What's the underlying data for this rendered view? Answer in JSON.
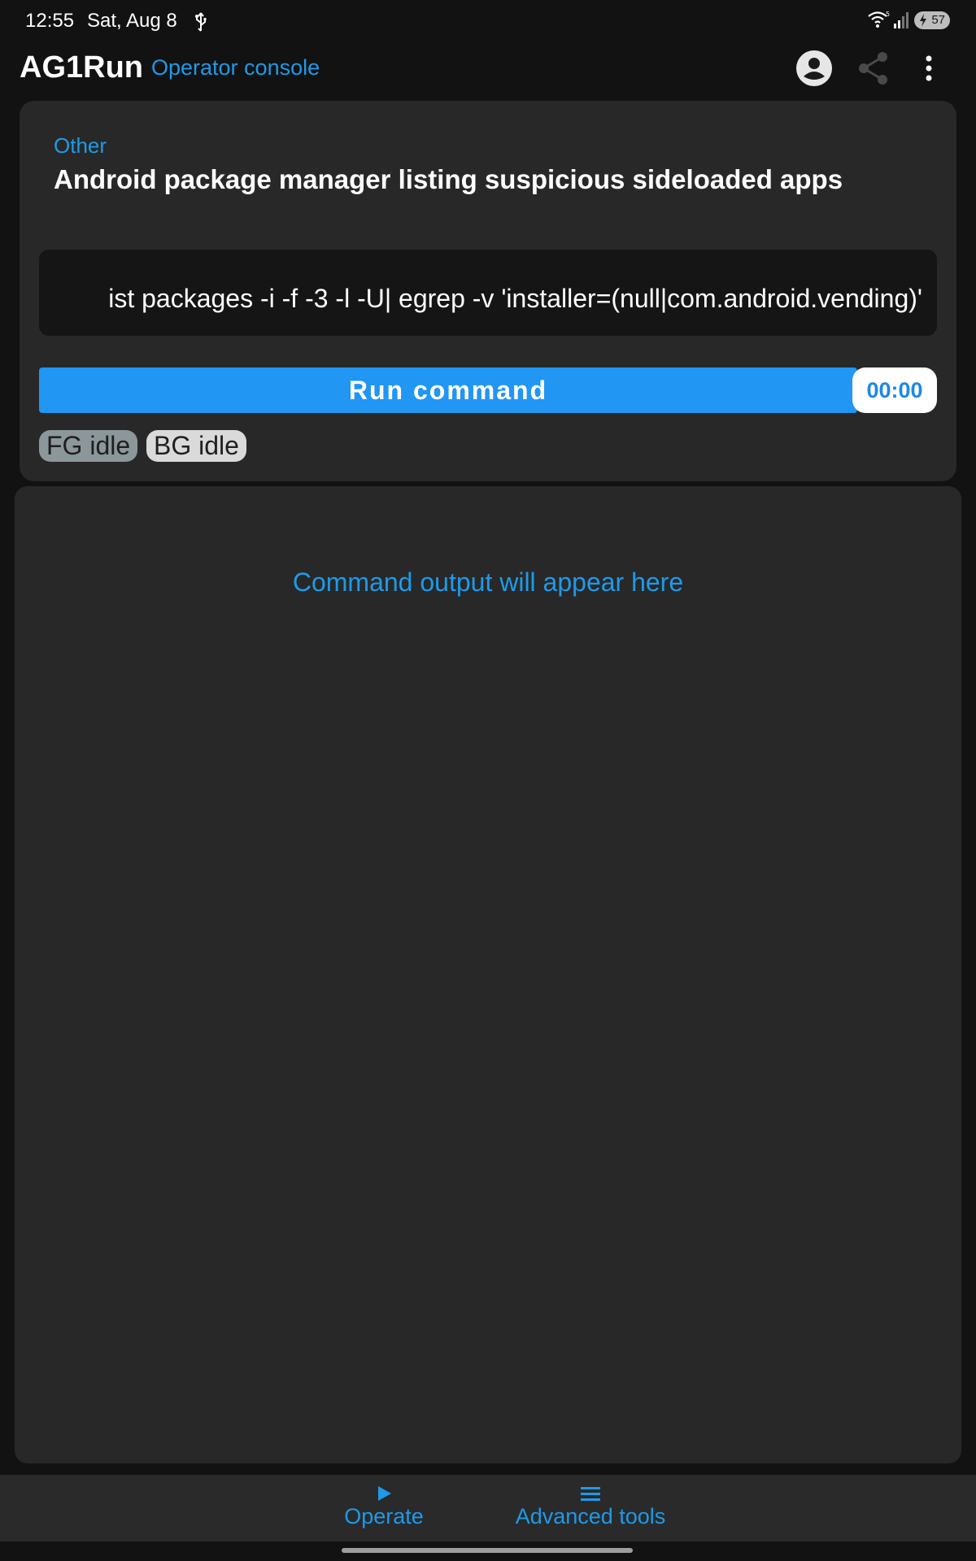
{
  "status_bar": {
    "time": "12:55",
    "date": "Sat, Aug 8",
    "battery": "57",
    "icons": [
      "usb-icon",
      "wifi-icon",
      "signal-icon",
      "battery-icon"
    ]
  },
  "app_bar": {
    "title": "AG1Run",
    "subtitle": "Operator console",
    "actions": [
      "account-icon",
      "share-icon",
      "more-vert-icon"
    ]
  },
  "command": {
    "category": "Other",
    "title": "Android package manager listing suspicious sideloaded apps",
    "input_value": "ist packages -i -f -3 -l -U| egrep -v 'installer=(null|com.android.vending)'",
    "run_label": "Run command",
    "timer": "00:00",
    "chips": [
      "FG idle",
      "BG idle"
    ]
  },
  "output": {
    "placeholder": "Command output will appear here"
  },
  "bottom_nav": {
    "items": [
      {
        "label": "Operate",
        "icon": "play-icon"
      },
      {
        "label": "Advanced tools",
        "icon": "menu-icon"
      }
    ]
  },
  "colors": {
    "accent": "#1e9ae9",
    "run_button": "#2196f3",
    "card": "#282828",
    "background": "#121212"
  }
}
